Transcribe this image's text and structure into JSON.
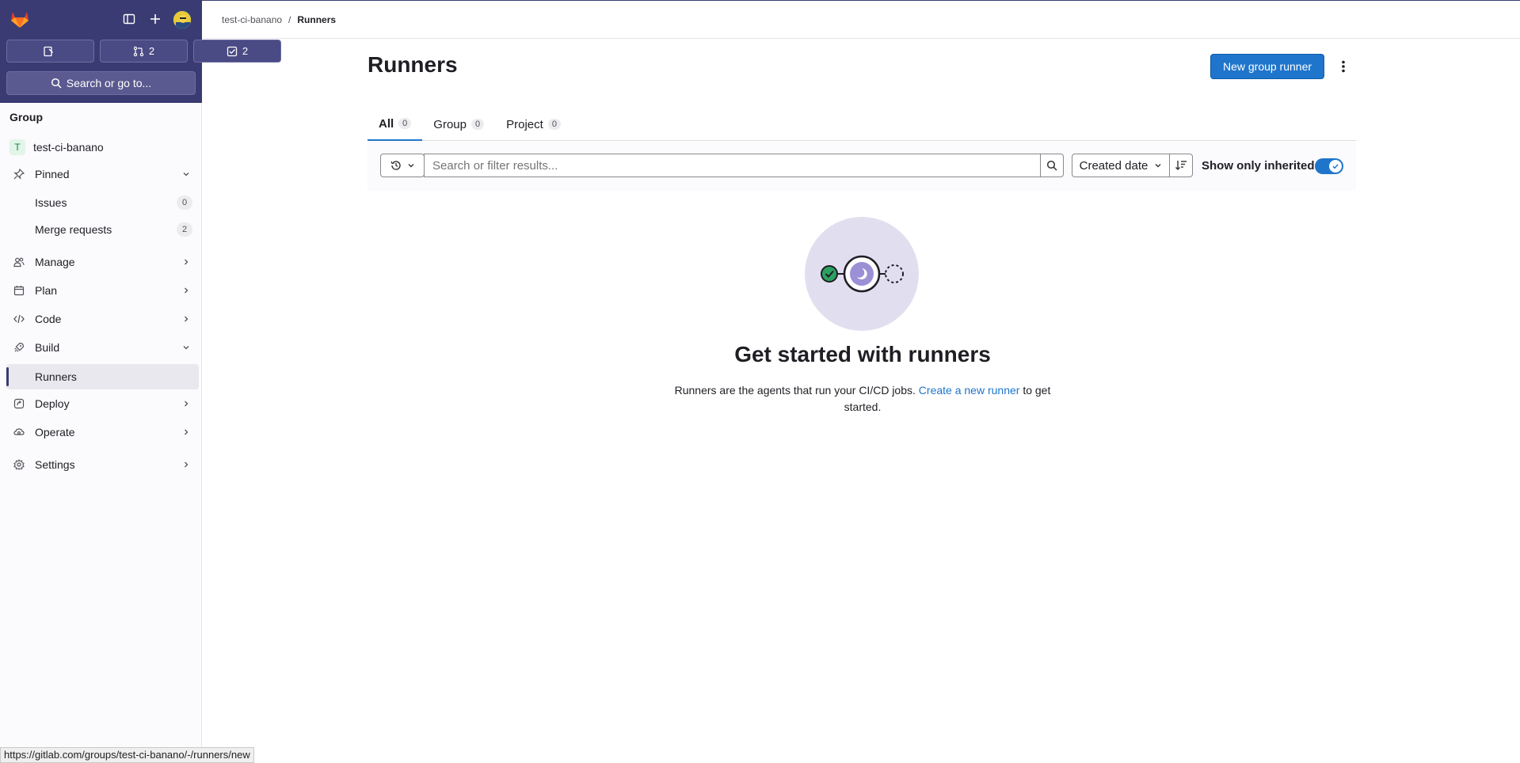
{
  "sidebar": {
    "counters": [
      {
        "icon": "issues-icon",
        "count": ""
      },
      {
        "icon": "merge-request-icon",
        "count": "2"
      },
      {
        "icon": "todo-icon",
        "count": "2"
      }
    ],
    "search_label": "Search or go to...",
    "context_title": "Group",
    "group_initial": "T",
    "group_name": "test-ci-banano",
    "pinned": "Pinned",
    "issues": {
      "label": "Issues",
      "count": "0"
    },
    "merge_requests": {
      "label": "Merge requests",
      "count": "2"
    },
    "manage": "Manage",
    "plan": "Plan",
    "code": "Code",
    "build": "Build",
    "runners": "Runners",
    "deploy": "Deploy",
    "operate": "Operate",
    "settings": "Settings"
  },
  "breadcrumb": {
    "group": "test-ci-banano",
    "separator": "/",
    "current": "Runners"
  },
  "page": {
    "title": "Runners",
    "new_runner_button": "New group runner"
  },
  "tabs": [
    {
      "label": "All",
      "count": "0"
    },
    {
      "label": "Group",
      "count": "0"
    },
    {
      "label": "Project",
      "count": "0"
    }
  ],
  "filter": {
    "placeholder": "Search or filter results...",
    "sort_label": "Created date",
    "inherited_label": "Show only inherited",
    "inherited_enabled": true
  },
  "empty_state": {
    "title": "Get started with runners",
    "desc_before": "Runners are the agents that run your CI/CD jobs.",
    "link_text": "Create a new runner",
    "desc_after": "to get started."
  },
  "status_bar_url": "https://gitlab.com/groups/test-ci-banano/-/runners/new",
  "colors": {
    "brand_sidebar": "#3b3b73",
    "primary": "#1f75cb"
  }
}
